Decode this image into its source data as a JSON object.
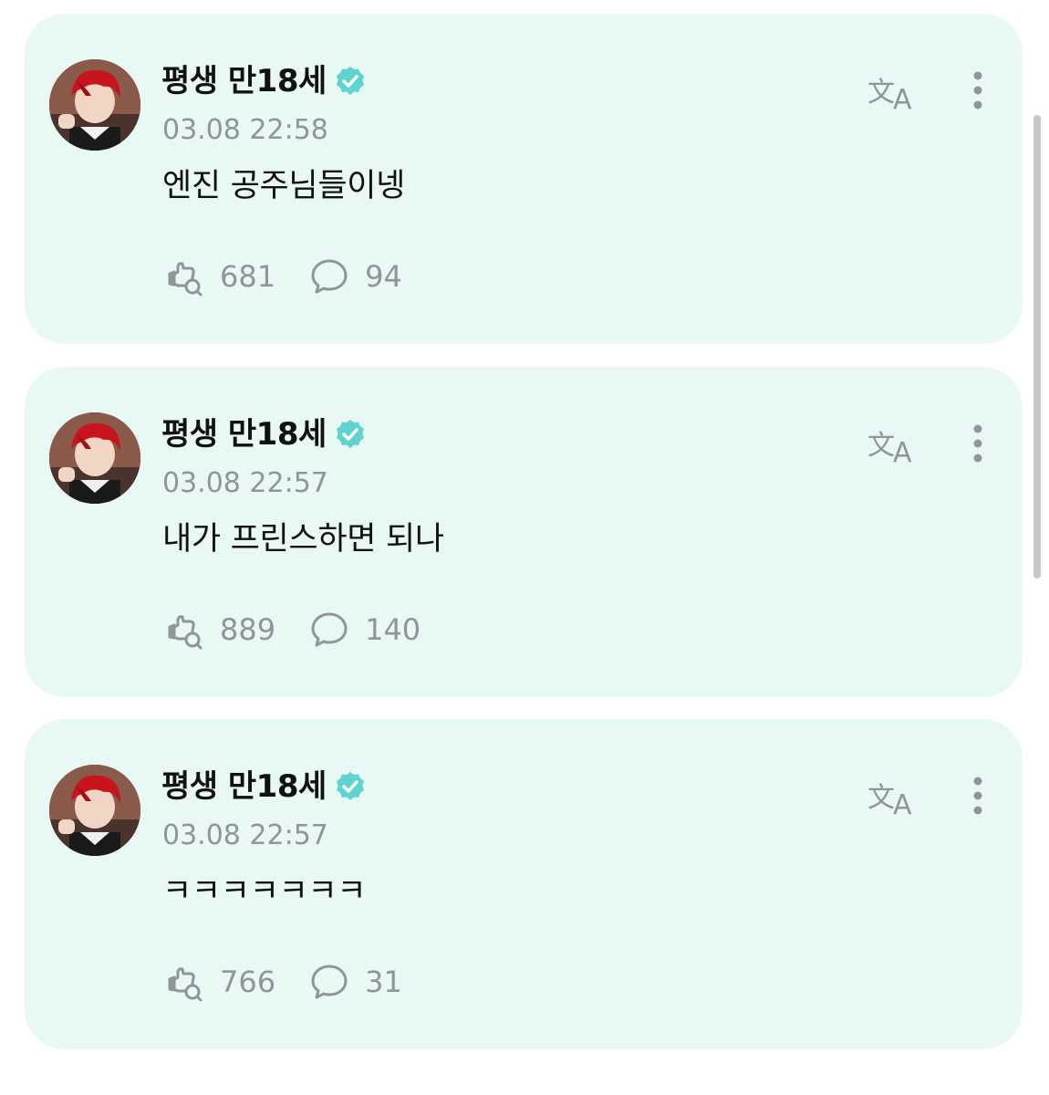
{
  "posts": [
    {
      "author": "평생 만18세",
      "time": "03.08 22:58",
      "text": "엔진 공주님들이넹",
      "likes": "681",
      "comments": "94"
    },
    {
      "author": "평생 만18세",
      "time": "03.08 22:57",
      "text": "내가 프린스하면 되나",
      "likes": "889",
      "comments": "140"
    },
    {
      "author": "평생 만18세",
      "time": "03.08 22:57",
      "text": "ㅋㅋㅋㅋㅋㅋㅋ",
      "likes": "766",
      "comments": "31"
    }
  ],
  "icons": {
    "verified": "verified-badge-icon",
    "translate": "translate-icon",
    "more": "more-vertical-icon",
    "like": "like-icon",
    "comment": "comment-icon"
  },
  "colors": {
    "card_background": "#e8f8f5",
    "verified_badge": "#5fd3cf",
    "icon_gray": "#8f9598",
    "text_primary": "#111111"
  }
}
